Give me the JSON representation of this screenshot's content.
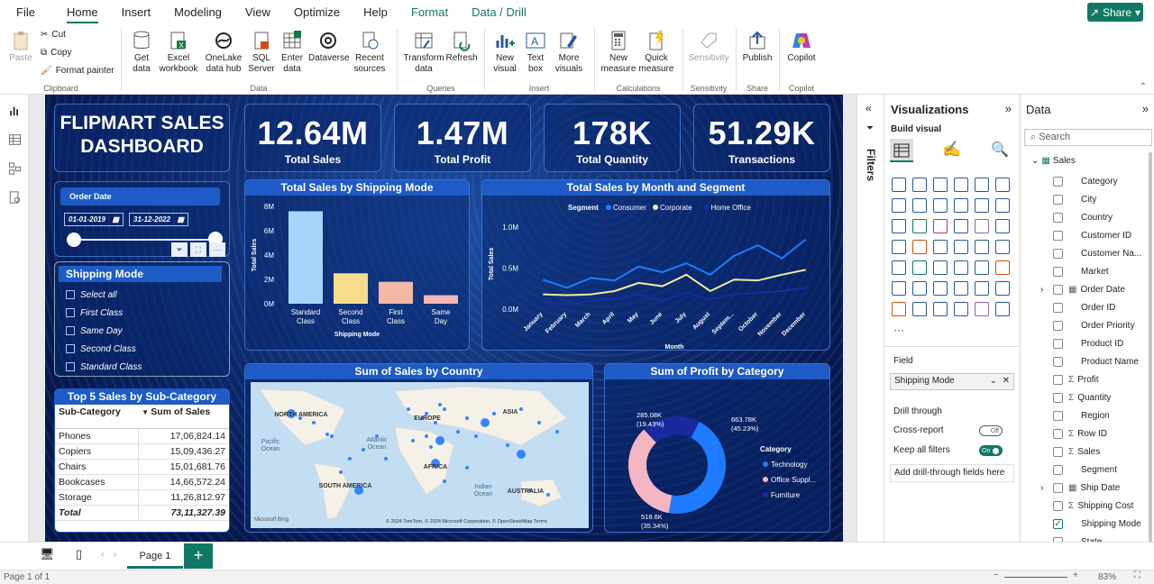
{
  "menu": {
    "tabs": [
      "File",
      "Home",
      "Insert",
      "Modeling",
      "View",
      "Optimize",
      "Help",
      "Format",
      "Data / Drill"
    ],
    "share": "Share"
  },
  "ribbon": {
    "clipboard": {
      "paste": "Paste",
      "cut": "Cut",
      "copy": "Copy",
      "format_painter": "Format painter",
      "group": "Clipboard"
    },
    "data": {
      "get_data": "Get\ndata",
      "excel": "Excel\nworkbook",
      "onelake": "OneLake\ndata hub",
      "sql": "SQL\nServer",
      "enter": "Enter\ndata",
      "dataverse": "Dataverse",
      "recent": "Recent\nsources",
      "group": "Data"
    },
    "queries": {
      "transform": "Transform\ndata",
      "refresh": "Refresh",
      "group": "Queries"
    },
    "insert": {
      "new_visual": "New\nvisual",
      "text_box": "Text\nbox",
      "more_visuals": "More\nvisuals",
      "group": "Insert"
    },
    "calc": {
      "new_measure": "New\nmeasure",
      "quick_measure": "Quick\nmeasure",
      "group": "Calculations"
    },
    "sens": {
      "label": "Sensitivity",
      "group": "Sensitivity"
    },
    "share": {
      "publish": "Publish",
      "group": "Share"
    },
    "copilot": {
      "label": "Copilot",
      "group": "Copilot"
    }
  },
  "dashboard": {
    "title": "FLIPMART SALES DASHBOARD",
    "kpis": [
      {
        "value": "12.64M",
        "label": "Total Sales"
      },
      {
        "value": "1.47M",
        "label": "Total Profit"
      },
      {
        "value": "178K",
        "label": "Total Quantity"
      },
      {
        "value": "51.29K",
        "label": "Transactions"
      }
    ],
    "order_date": {
      "label": "Order Date",
      "start": "01-01-2019",
      "end": "31-12-2022"
    },
    "shipping_slicer": {
      "title": "Shipping Mode",
      "items": [
        "Select all",
        "First Class",
        "Same Day",
        "Second Class",
        "Standard Class"
      ]
    },
    "top5": {
      "title": "Top 5 Sales by Sub-Category",
      "headers": [
        "Sub-Category",
        "Sum of Sales"
      ],
      "rows": [
        [
          "Phones",
          "17,06,824.14"
        ],
        [
          "Copiers",
          "15,09,436.27"
        ],
        [
          "Chairs",
          "15,01,681.76"
        ],
        [
          "Bookcases",
          "14,66,572.24"
        ],
        [
          "Storage",
          "11,26,812.97"
        ]
      ],
      "total": [
        "Total",
        "73,11,327.39"
      ]
    },
    "map": {
      "title": "Sum of Sales by Country",
      "labels": [
        "NORTH AMERICA",
        "EUROPE",
        "ASIA",
        "AFRICA",
        "SOUTH AMERICA",
        "AUSTRALIA",
        "Atlantic\nOcean",
        "Pacific\nOcean",
        "Indian\nOcean"
      ],
      "attribution": "© 2024 TomTom, © 2024 Microsoft Corporation, © OpenStreetMap  Terms",
      "brand": "Microsoft Bing"
    }
  },
  "chart_data": [
    {
      "type": "bar",
      "title": "Total Sales by Shipping Mode",
      "xlabel": "Shipping Mode",
      "ylabel": "Total Sales",
      "categories": [
        "Standard Class",
        "Second Class",
        "First Class",
        "Same Day"
      ],
      "values": [
        7.6,
        2.5,
        1.8,
        0.7
      ],
      "unit": "M",
      "yticks": [
        "0M",
        "2M",
        "4M",
        "6M",
        "8M"
      ],
      "ylim": [
        0,
        8
      ],
      "colors": [
        "#a7d4fb",
        "#f6dd8b",
        "#f4b9a6",
        "#f4b6b6"
      ]
    },
    {
      "type": "line",
      "title": "Total Sales by Month and Segment",
      "xlabel": "Month",
      "ylabel": "Total Sales",
      "legend_title": "Segment",
      "categories": [
        "January",
        "February",
        "March",
        "April",
        "May",
        "June",
        "July",
        "August",
        "Septem...",
        "October",
        "November",
        "December"
      ],
      "ylim": [
        0,
        1.1
      ],
      "yticks": [
        "0.0M",
        "0.5M",
        "1.0M"
      ],
      "series": [
        {
          "name": "Consumer",
          "color": "#1f7bff",
          "values": [
            0.36,
            0.26,
            0.38,
            0.35,
            0.52,
            0.45,
            0.56,
            0.42,
            0.65,
            0.78,
            0.62,
            0.85
          ]
        },
        {
          "name": "Corporate",
          "color": "#f3e9a8",
          "values": [
            0.18,
            0.17,
            0.18,
            0.22,
            0.32,
            0.28,
            0.42,
            0.22,
            0.36,
            0.35,
            0.42,
            0.48
          ]
        },
        {
          "name": "Home Office",
          "color": "#1a2a9e",
          "values": [
            0.08,
            0.06,
            0.1,
            0.12,
            0.18,
            0.1,
            0.2,
            0.12,
            0.18,
            0.2,
            0.22,
            0.26
          ]
        }
      ]
    },
    {
      "type": "pie",
      "title": "Sum of Profit by Category",
      "legend_title": "Category",
      "categories": [
        "Technology",
        "Office Suppl...",
        "Furniture"
      ],
      "values": [
        663.78,
        518.6,
        285.08
      ],
      "labels": [
        "663.78K\n(45.23%)",
        "518.6K\n(35.34%)",
        "285.08K\n(19.43%)"
      ],
      "colors": [
        "#1f7bff",
        "#f4b6c2",
        "#1a2a9e"
      ]
    }
  ],
  "filters_label": "Filters",
  "viz": {
    "title": "Visualizations",
    "build": "Build visual",
    "field_label": "Field",
    "field_value": "Shipping Mode",
    "drill_label": "Drill through",
    "cross_report": "Cross-report",
    "cross_state": "Off",
    "keep_filters": "Keep all filters",
    "keep_state": "On",
    "add_drill": "Add drill-through fields here"
  },
  "data_pane": {
    "title": "Data",
    "search_placeholder": "Search",
    "table": "Sales",
    "fields": [
      {
        "n": "Category"
      },
      {
        "n": "City"
      },
      {
        "n": "Country"
      },
      {
        "n": "Customer ID"
      },
      {
        "n": "Customer Na..."
      },
      {
        "n": "Market"
      },
      {
        "n": "Order Date",
        "t": "date"
      },
      {
        "n": "Order ID"
      },
      {
        "n": "Order Priority"
      },
      {
        "n": "Product ID"
      },
      {
        "n": "Product Name"
      },
      {
        "n": "Profit",
        "t": "sum"
      },
      {
        "n": "Quantity",
        "t": "sum"
      },
      {
        "n": "Region"
      },
      {
        "n": "Row ID",
        "t": "sum"
      },
      {
        "n": "Sales",
        "t": "sum"
      },
      {
        "n": "Segment"
      },
      {
        "n": "Ship Date",
        "t": "date"
      },
      {
        "n": "Shipping Cost",
        "t": "sum"
      },
      {
        "n": "Shipping Mode",
        "checked": true
      },
      {
        "n": "State"
      },
      {
        "n": "Sub-Category"
      }
    ]
  },
  "pages": {
    "current": "Page 1",
    "status": "Page 1 of 1",
    "zoom": "83%"
  }
}
